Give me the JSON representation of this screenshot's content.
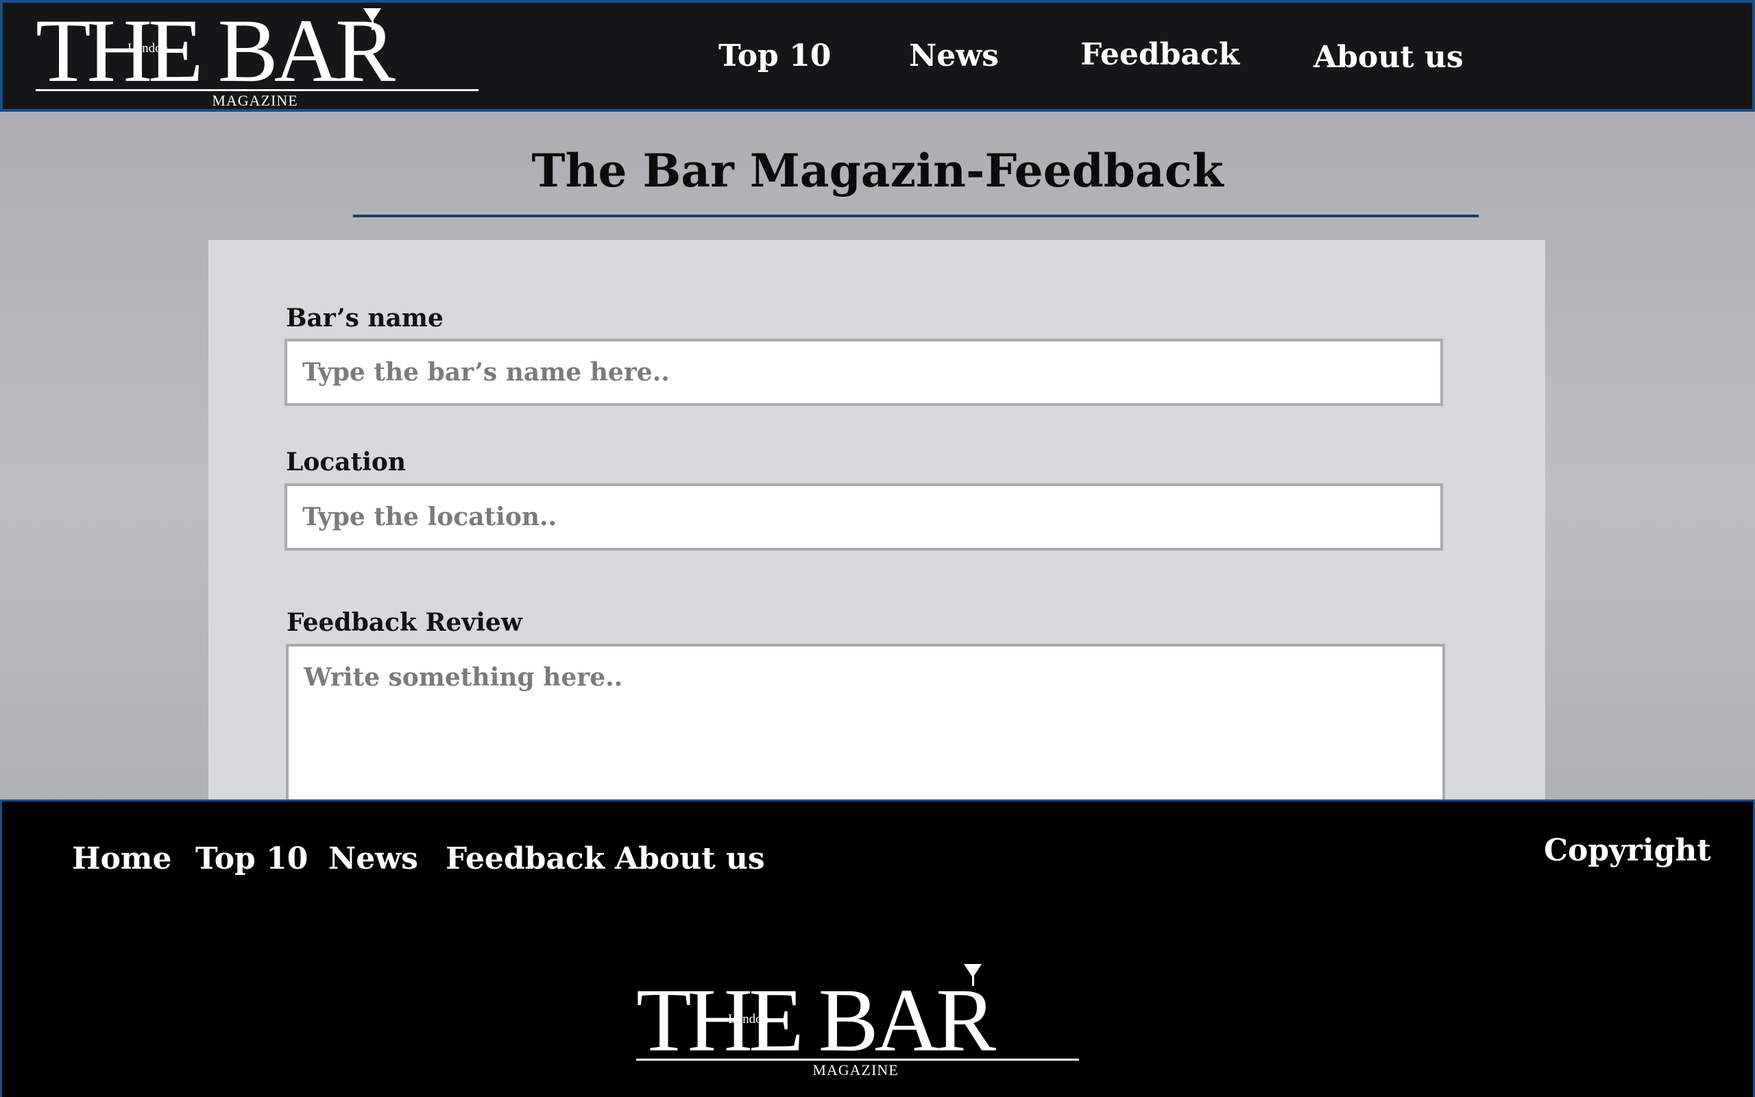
{
  "header": {
    "logo": {
      "title": "THE BAR",
      "city": "London",
      "subtitle": "MAGAZINE"
    },
    "nav": [
      {
        "label": "Top 10"
      },
      {
        "label": "News"
      },
      {
        "label": "Feedback"
      },
      {
        "label": "About us"
      }
    ]
  },
  "main": {
    "title": "The Bar Magazin-Feedback",
    "form": {
      "bar_name": {
        "label": "Bar’s name",
        "placeholder": "Type the bar’s name here.."
      },
      "location": {
        "label": "Location",
        "placeholder": "Type the location.."
      },
      "feedback": {
        "label": "Feedback Review",
        "placeholder": "Write something here.."
      }
    }
  },
  "footer": {
    "nav": [
      {
        "label": "Home"
      },
      {
        "label": "Top 10"
      },
      {
        "label": "News"
      },
      {
        "label": "Feedback"
      },
      {
        "label": "About us"
      }
    ],
    "copyright": "Copyright",
    "logo": {
      "title": "THE BAR",
      "city": "London",
      "subtitle": "MAGAZINE"
    }
  },
  "colors": {
    "header_bg": "#161618",
    "border_accent": "#1c4f86",
    "title_rule": "#1c3f6e",
    "panel_bg": "#d7d8db",
    "footer_bg": "#000000"
  }
}
